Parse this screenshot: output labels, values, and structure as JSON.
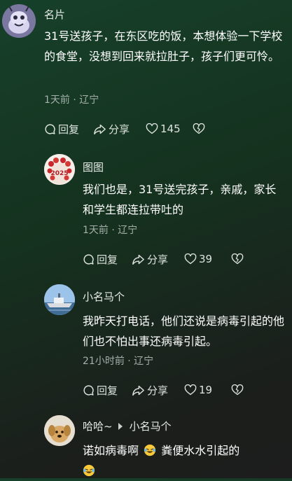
{
  "comments": [
    {
      "username": "名片",
      "text": "31号送孩子，在东区吃的饭，本想体验一下学校的食堂，没想到回来就拉肚子，孩子们更可怜。",
      "meta": "1天前 · 辽宁",
      "reply_label": "回复",
      "share_label": "分享",
      "likes": "145"
    },
    {
      "username": "图图",
      "text": "我们也是，31号送完孩子，亲戚，家长和学生都连拉带吐的",
      "meta": "1天前 · 辽宁",
      "reply_label": "回复",
      "share_label": "分享",
      "likes": "39"
    },
    {
      "username": "小名马个",
      "text": "我昨天打电话，他们还说是病毒引起的他们也不怕出事还病毒引起。",
      "meta": "21小时前 · 辽宁",
      "reply_label": "回复",
      "share_label": "分享",
      "likes": "19"
    },
    {
      "username": "哈哈~",
      "reply_to": "小名马个",
      "text_part1": "诺如病毒啊",
      "text_part2": "粪便水水引起的"
    }
  ],
  "avatar_badge_text": "2025",
  "emoji_names": [
    "laughing-emoji",
    "laughing-emoji"
  ],
  "colors": {
    "background_top": "#16402a",
    "background_bottom": "#1d1d1d",
    "meta_text": "#a6b0ab"
  }
}
